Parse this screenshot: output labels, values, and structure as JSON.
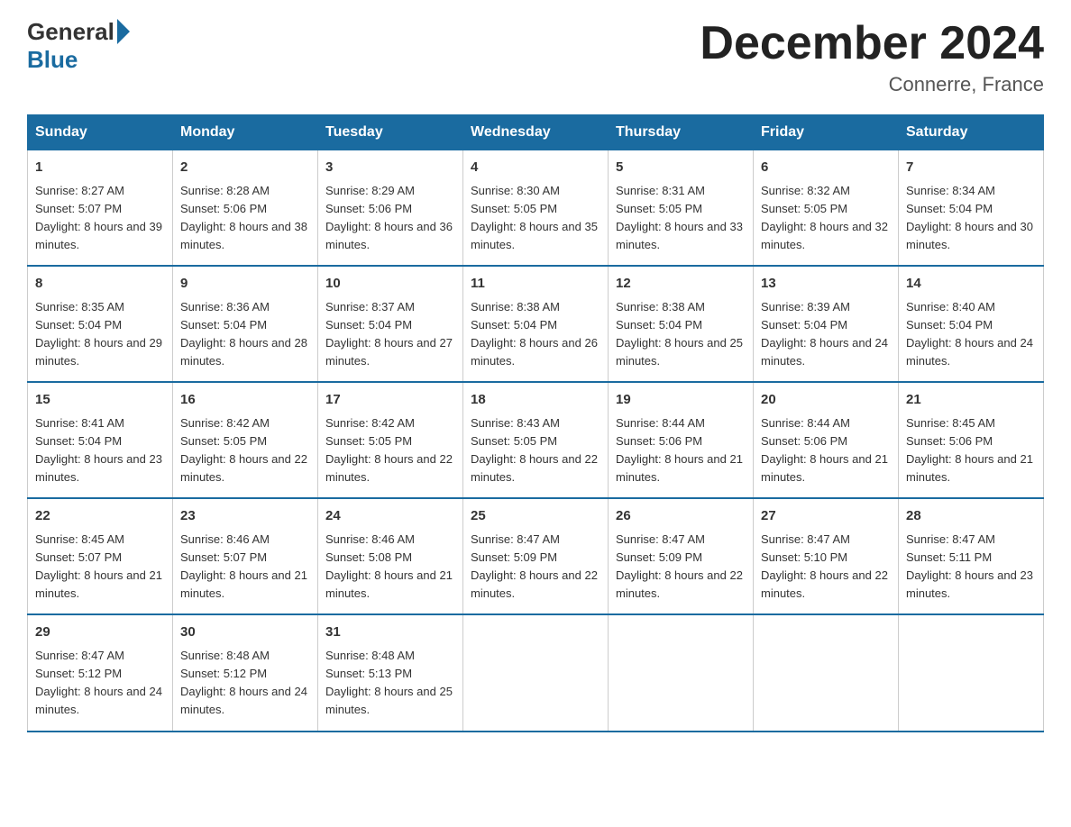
{
  "header": {
    "logo_general": "General",
    "logo_blue": "Blue",
    "month_title": "December 2024",
    "location": "Connerre, France"
  },
  "days_of_week": [
    "Sunday",
    "Monday",
    "Tuesday",
    "Wednesday",
    "Thursday",
    "Friday",
    "Saturday"
  ],
  "weeks": [
    [
      {
        "day": "1",
        "sunrise": "8:27 AM",
        "sunset": "5:07 PM",
        "daylight": "8 hours and 39 minutes."
      },
      {
        "day": "2",
        "sunrise": "8:28 AM",
        "sunset": "5:06 PM",
        "daylight": "8 hours and 38 minutes."
      },
      {
        "day": "3",
        "sunrise": "8:29 AM",
        "sunset": "5:06 PM",
        "daylight": "8 hours and 36 minutes."
      },
      {
        "day": "4",
        "sunrise": "8:30 AM",
        "sunset": "5:05 PM",
        "daylight": "8 hours and 35 minutes."
      },
      {
        "day": "5",
        "sunrise": "8:31 AM",
        "sunset": "5:05 PM",
        "daylight": "8 hours and 33 minutes."
      },
      {
        "day": "6",
        "sunrise": "8:32 AM",
        "sunset": "5:05 PM",
        "daylight": "8 hours and 32 minutes."
      },
      {
        "day": "7",
        "sunrise": "8:34 AM",
        "sunset": "5:04 PM",
        "daylight": "8 hours and 30 minutes."
      }
    ],
    [
      {
        "day": "8",
        "sunrise": "8:35 AM",
        "sunset": "5:04 PM",
        "daylight": "8 hours and 29 minutes."
      },
      {
        "day": "9",
        "sunrise": "8:36 AM",
        "sunset": "5:04 PM",
        "daylight": "8 hours and 28 minutes."
      },
      {
        "day": "10",
        "sunrise": "8:37 AM",
        "sunset": "5:04 PM",
        "daylight": "8 hours and 27 minutes."
      },
      {
        "day": "11",
        "sunrise": "8:38 AM",
        "sunset": "5:04 PM",
        "daylight": "8 hours and 26 minutes."
      },
      {
        "day": "12",
        "sunrise": "8:38 AM",
        "sunset": "5:04 PM",
        "daylight": "8 hours and 25 minutes."
      },
      {
        "day": "13",
        "sunrise": "8:39 AM",
        "sunset": "5:04 PM",
        "daylight": "8 hours and 24 minutes."
      },
      {
        "day": "14",
        "sunrise": "8:40 AM",
        "sunset": "5:04 PM",
        "daylight": "8 hours and 24 minutes."
      }
    ],
    [
      {
        "day": "15",
        "sunrise": "8:41 AM",
        "sunset": "5:04 PM",
        "daylight": "8 hours and 23 minutes."
      },
      {
        "day": "16",
        "sunrise": "8:42 AM",
        "sunset": "5:05 PM",
        "daylight": "8 hours and 22 minutes."
      },
      {
        "day": "17",
        "sunrise": "8:42 AM",
        "sunset": "5:05 PM",
        "daylight": "8 hours and 22 minutes."
      },
      {
        "day": "18",
        "sunrise": "8:43 AM",
        "sunset": "5:05 PM",
        "daylight": "8 hours and 22 minutes."
      },
      {
        "day": "19",
        "sunrise": "8:44 AM",
        "sunset": "5:06 PM",
        "daylight": "8 hours and 21 minutes."
      },
      {
        "day": "20",
        "sunrise": "8:44 AM",
        "sunset": "5:06 PM",
        "daylight": "8 hours and 21 minutes."
      },
      {
        "day": "21",
        "sunrise": "8:45 AM",
        "sunset": "5:06 PM",
        "daylight": "8 hours and 21 minutes."
      }
    ],
    [
      {
        "day": "22",
        "sunrise": "8:45 AM",
        "sunset": "5:07 PM",
        "daylight": "8 hours and 21 minutes."
      },
      {
        "day": "23",
        "sunrise": "8:46 AM",
        "sunset": "5:07 PM",
        "daylight": "8 hours and 21 minutes."
      },
      {
        "day": "24",
        "sunrise": "8:46 AM",
        "sunset": "5:08 PM",
        "daylight": "8 hours and 21 minutes."
      },
      {
        "day": "25",
        "sunrise": "8:47 AM",
        "sunset": "5:09 PM",
        "daylight": "8 hours and 22 minutes."
      },
      {
        "day": "26",
        "sunrise": "8:47 AM",
        "sunset": "5:09 PM",
        "daylight": "8 hours and 22 minutes."
      },
      {
        "day": "27",
        "sunrise": "8:47 AM",
        "sunset": "5:10 PM",
        "daylight": "8 hours and 22 minutes."
      },
      {
        "day": "28",
        "sunrise": "8:47 AM",
        "sunset": "5:11 PM",
        "daylight": "8 hours and 23 minutes."
      }
    ],
    [
      {
        "day": "29",
        "sunrise": "8:47 AM",
        "sunset": "5:12 PM",
        "daylight": "8 hours and 24 minutes."
      },
      {
        "day": "30",
        "sunrise": "8:48 AM",
        "sunset": "5:12 PM",
        "daylight": "8 hours and 24 minutes."
      },
      {
        "day": "31",
        "sunrise": "8:48 AM",
        "sunset": "5:13 PM",
        "daylight": "8 hours and 25 minutes."
      },
      null,
      null,
      null,
      null
    ]
  ]
}
